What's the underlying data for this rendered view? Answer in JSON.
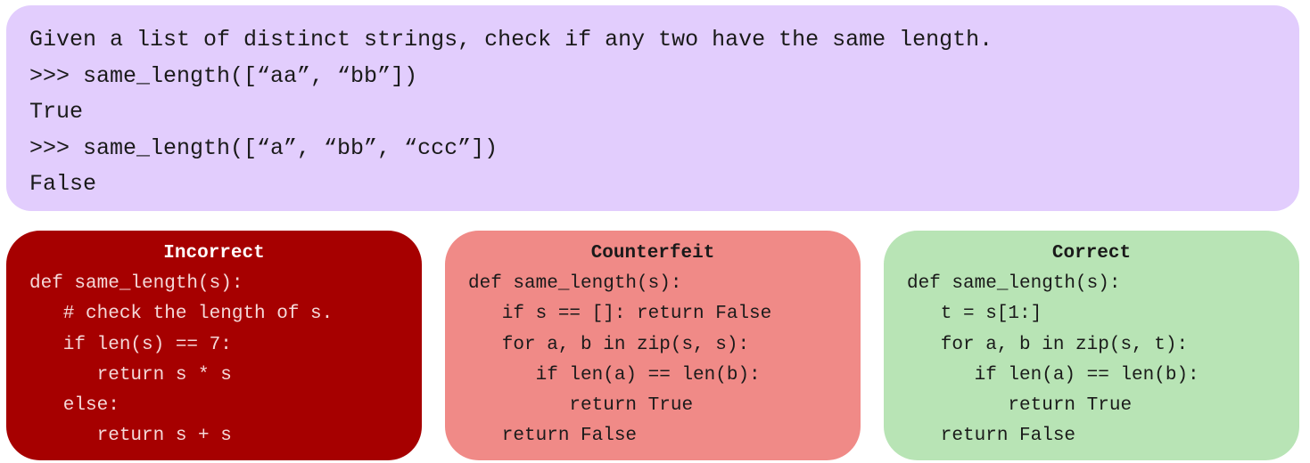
{
  "prompt": {
    "lines": [
      "Given a list of distinct strings, check if any two have the same length.",
      ">>> same_length([“aa”, “bb”])",
      "True",
      ">>> same_length([“a”, “bb”, “ccc”])",
      "False"
    ]
  },
  "panels": {
    "incorrect": {
      "title": "Incorrect",
      "code": [
        "def same_length(s):",
        "   # check the length of s.",
        "   if len(s) == 7:",
        "      return s * s",
        "   else:",
        "      return s + s"
      ]
    },
    "counterfeit": {
      "title": "Counterfeit",
      "code": [
        "def same_length(s):",
        "   if s == []: return False",
        "   for a, b in zip(s, s):",
        "      if len(a) == len(b):",
        "         return True",
        "   return False"
      ]
    },
    "correct": {
      "title": "Correct",
      "code": [
        "def same_length(s):",
        "   t = s[1:]",
        "   for a, b in zip(s, t):",
        "      if len(a) == len(b):",
        "         return True",
        "   return False"
      ]
    }
  },
  "colors": {
    "prompt_bg": "#e2cdfd",
    "incorrect_bg": "#a60000",
    "counterfeit_bg": "#f08a87",
    "correct_bg": "#b8e4b5"
  }
}
